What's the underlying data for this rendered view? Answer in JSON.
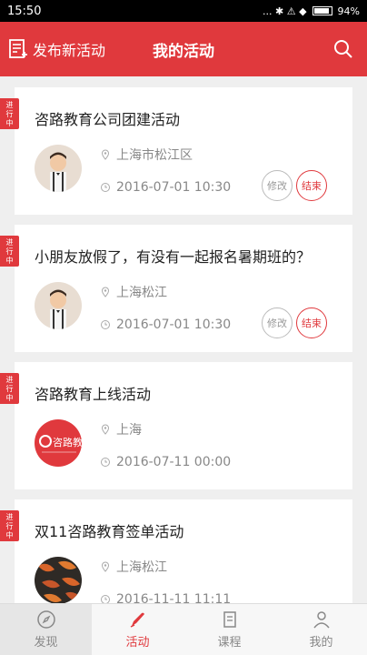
{
  "status_bar": {
    "time": "15:50",
    "indicators": "... ✱ ⚠ ◆",
    "battery_percent": "94%",
    "battery_level": 0.94
  },
  "header": {
    "publish_label": "发布新活动",
    "title": "我的活动"
  },
  "status_tag": "进行中",
  "activities": [
    {
      "title": "咨路教育公司团建活动",
      "location": "上海市松江区",
      "time": "2016-07-01 10:30",
      "avatar": "child",
      "edit_label": "修改",
      "end_label": "结束",
      "show_actions": true
    },
    {
      "title": "小朋友放假了，有没有一起报名暑期班的？",
      "location": "上海松江",
      "time": "2016-07-01 10:30",
      "avatar": "child",
      "edit_label": "修改",
      "end_label": "结束",
      "show_actions": true
    },
    {
      "title": "咨路教育上线活动",
      "location": "上海",
      "time": "2016-07-11 00:00",
      "avatar": "logo",
      "logo_text": "咨路教育",
      "show_actions": false
    },
    {
      "title": "双11咨路教育签单活动",
      "location": "上海松江",
      "time": "2016-11-11 11:11",
      "avatar": "pattern",
      "show_actions": false
    }
  ],
  "tabs": [
    {
      "label": "发现",
      "icon": "compass-icon"
    },
    {
      "label": "活动",
      "icon": "pen-icon"
    },
    {
      "label": "课程",
      "icon": "course-icon"
    },
    {
      "label": "我的",
      "icon": "person-icon"
    }
  ],
  "colors": {
    "accent": "#e0393d"
  }
}
